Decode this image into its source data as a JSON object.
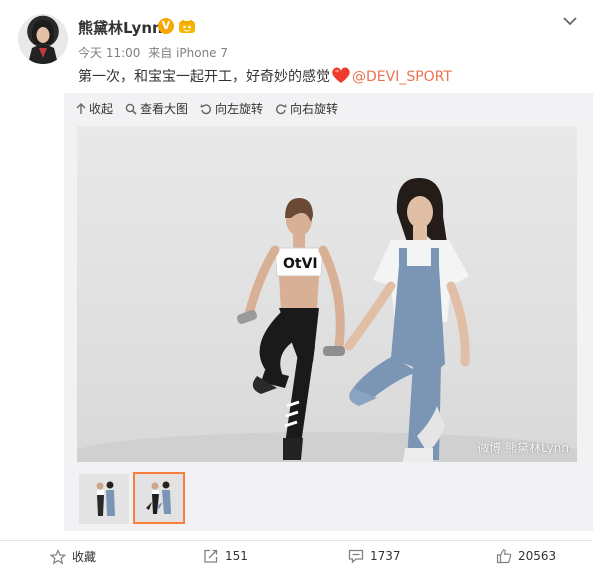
{
  "post": {
    "username": "熊黛林Lynn",
    "verified_badge": "V",
    "time": "今天 11:00",
    "source": "来自 iPhone 7",
    "text_before": "第一次，和宝宝一起开工，好奇妙的感觉",
    "mention": "@DEVI_SPORT",
    "mention_color": "#eb7350"
  },
  "toolbar": {
    "collapse": "收起",
    "view_large": "查看大图",
    "rotate_left": "向左旋转",
    "rotate_right": "向右旋转"
  },
  "photo": {
    "watermark": "微博 熊黛林Lynn",
    "shirt_text": "OtVI"
  },
  "thumbnails": {
    "count": 2,
    "selected_index": 1,
    "selected_border_color": "#fa7d3c"
  },
  "actions": {
    "favorite": "收藏",
    "repost_count": "151",
    "comment_count": "1737",
    "like_count": "20563"
  },
  "icons": {
    "verified": "v-badge-icon",
    "vip": "vip-crown-icon",
    "menu": "chevron-down-icon",
    "heart": "heart-emoji-icon",
    "collapse": "collapse-arrow-icon",
    "view_large": "magnifier-icon",
    "rotate_left": "rotate-left-icon",
    "rotate_right": "rotate-right-icon",
    "favorite": "star-icon",
    "repost": "repost-icon",
    "comment": "comment-icon",
    "like": "thumbs-up-icon"
  }
}
